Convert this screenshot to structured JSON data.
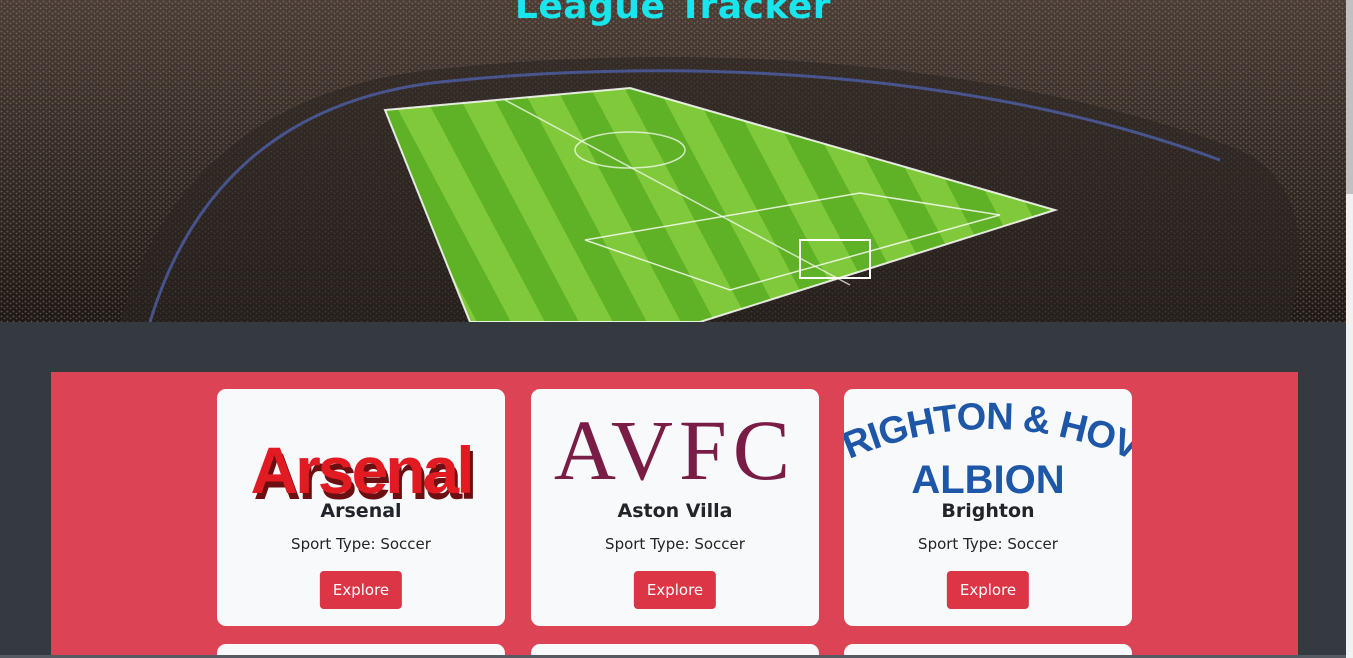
{
  "header": {
    "title": "League Tracker",
    "background_image": "stadium-photo"
  },
  "teams": [
    {
      "name": "Arsenal",
      "sport_type": "Sport Type: Soccer",
      "logo_text": "Arsenal",
      "button_label": "Explore",
      "logo_color": "#e21b23"
    },
    {
      "name": "Aston Villa",
      "sport_type": "Sport Type: Soccer",
      "logo_text": "AVFC",
      "button_label": "Explore",
      "logo_color": "#7a1d46"
    },
    {
      "name": "Brighton",
      "sport_type": "Sport Type: Soccer",
      "logo_text": "BRIGHTON & HOVE ALBION",
      "button_label": "Explore",
      "logo_color": "#1f57a8"
    }
  ],
  "colors": {
    "accent": "#19e6ec",
    "container": "#dc4354",
    "button": "#dc3545",
    "page_bg": "#343a40",
    "card_bg": "#f8f9fa"
  }
}
